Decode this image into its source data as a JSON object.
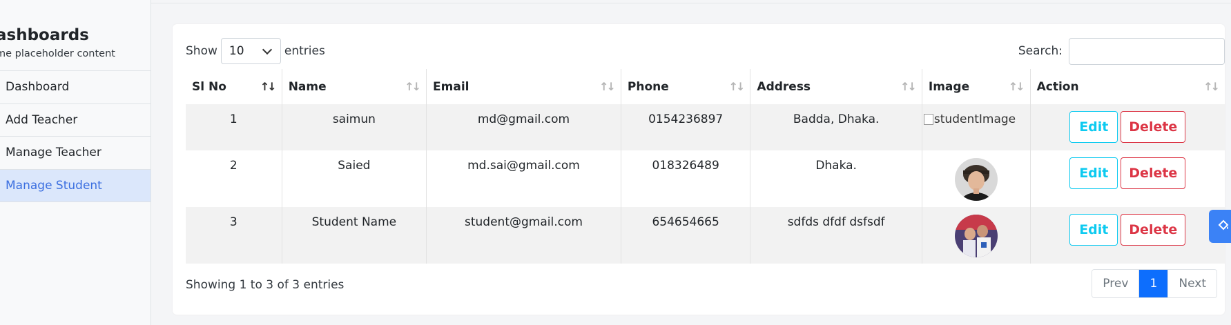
{
  "sidebar": {
    "title": "ashboards",
    "subtitle": "me placeholder content",
    "items": [
      {
        "label": "Dashboard",
        "active": false
      },
      {
        "label": "Add Teacher",
        "active": false
      },
      {
        "label": "Manage Teacher",
        "active": false
      },
      {
        "label": "Manage Student",
        "active": true
      }
    ]
  },
  "controls": {
    "show_label": "Show",
    "page_size": "10",
    "entries_label": "entries",
    "search_label": "Search:",
    "search_value": ""
  },
  "table": {
    "columns": [
      "Sl No",
      "Name",
      "Email",
      "Phone",
      "Address",
      "Image",
      "Action"
    ],
    "sorted_column": "Sl No",
    "rows": [
      {
        "sl": "1",
        "name": "saimun",
        "email": "md@gmail.com",
        "phone": "0154236897",
        "address": "Badda, Dhaka.",
        "image_alt": "studentImage",
        "image_state": "broken"
      },
      {
        "sl": "2",
        "name": "Saied",
        "email": "md.sai@gmail.com",
        "phone": "018326489",
        "address": "Dhaka.",
        "image_alt": "",
        "image_state": "avatar-boy"
      },
      {
        "sl": "3",
        "name": "Student Name",
        "email": "student@gmail.com",
        "phone": "654654665",
        "address": "sdfds dfdf dsfsdf",
        "image_alt": "",
        "image_state": "avatar-kids"
      }
    ],
    "edit_label": "Edit",
    "delete_label": "Delete"
  },
  "footer": {
    "info": "Showing 1 to 3 of 3 entries",
    "prev_label": "Prev",
    "current_page": "1",
    "next_label": "Next"
  },
  "colors": {
    "primary": "#0d6efd",
    "info": "#0dcaf0",
    "danger": "#dc3545",
    "active_nav_bg": "#dbe7fb"
  },
  "icons": {
    "sort": "sort-icon",
    "dropdown": "chevron-down-icon",
    "float": "paint-bucket-icon"
  }
}
